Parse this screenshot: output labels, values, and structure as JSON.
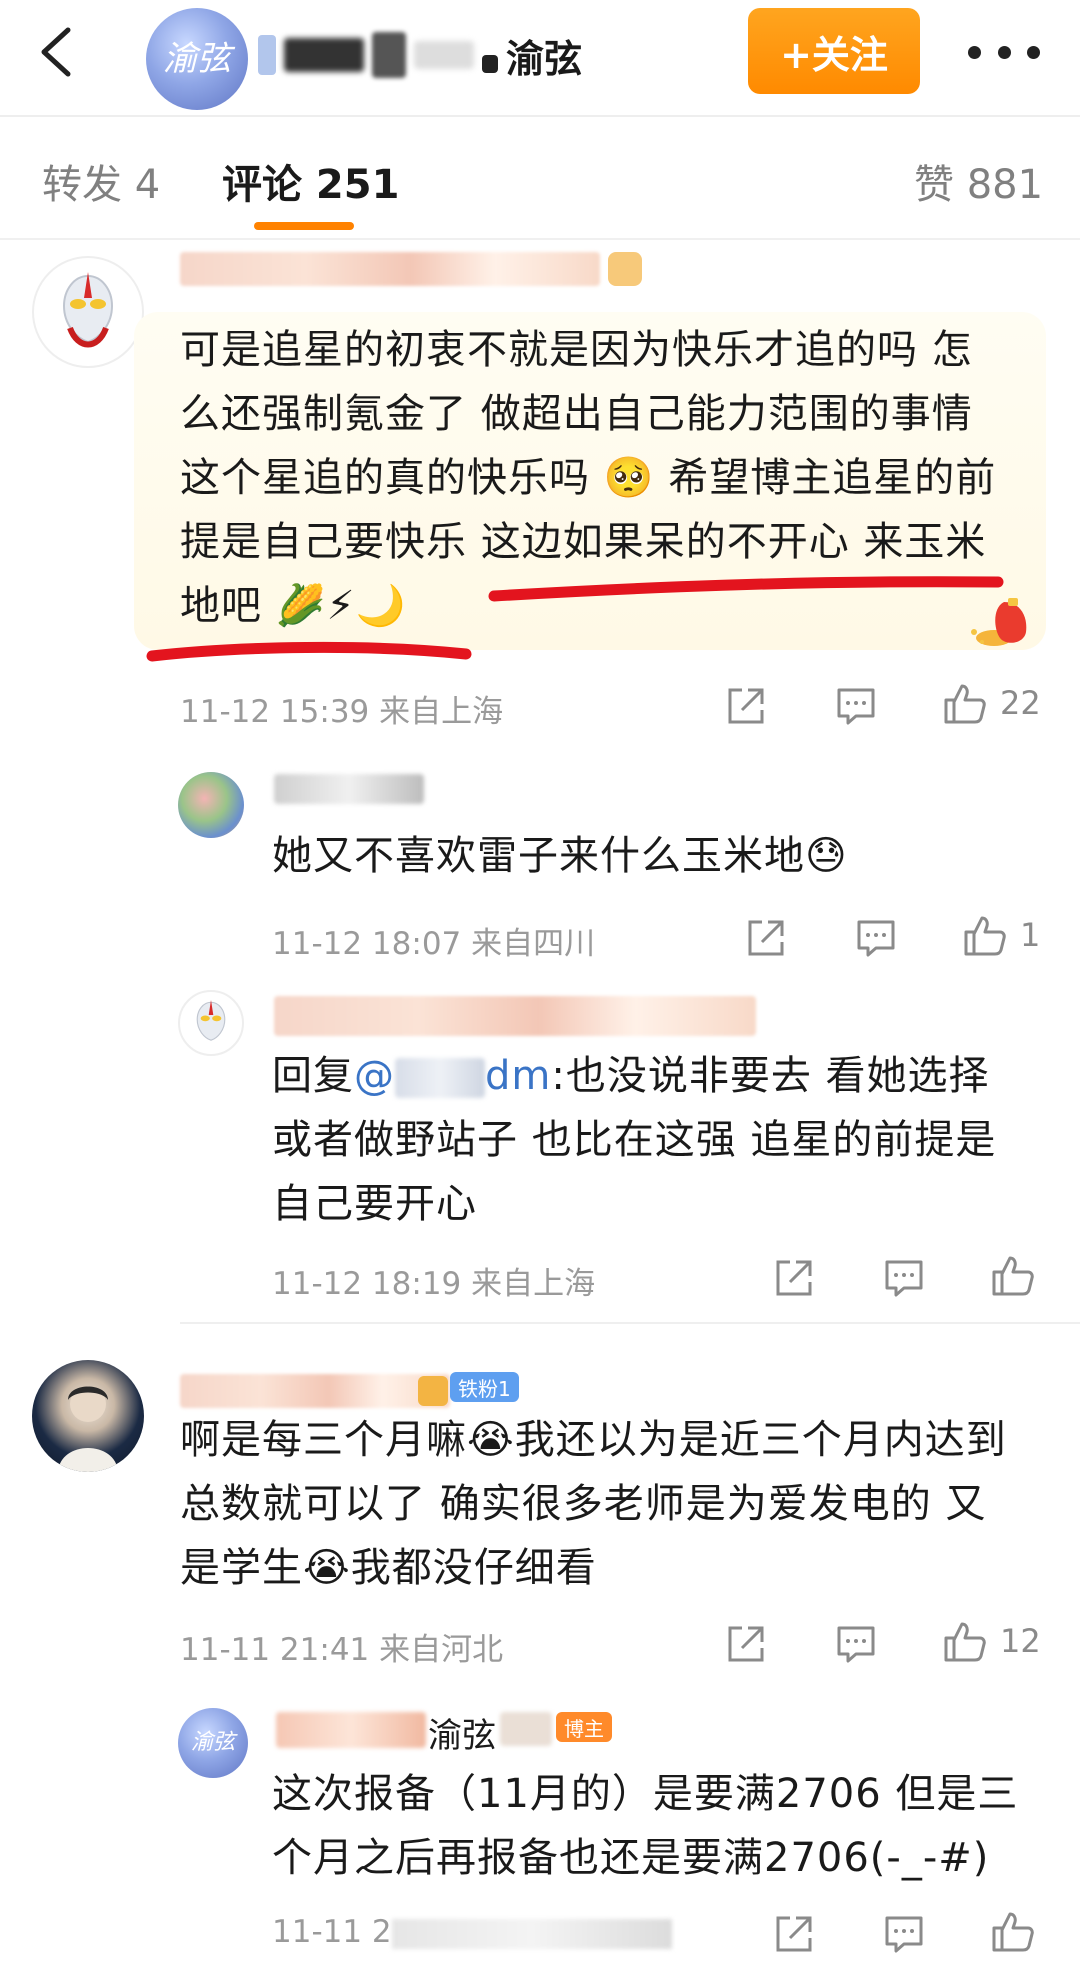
{
  "header": {
    "account_name_visible": "渝弦",
    "avatar_text": "渝弦",
    "follow_label": "+关注"
  },
  "tabs": [
    {
      "label": "转发 4"
    },
    {
      "label": "评论 251"
    },
    {
      "label": "赞 881"
    }
  ],
  "comments": [
    {
      "text_lines": [
        "可是追星的初衷不就是因为快乐才追的吗 怎",
        "么还强制氪金了 做超出自己能力范围的事情",
        "这个星追的真的快乐吗 🥺 希望博主追星的前",
        "提是自己要快乐 这边如果呆的不开心 来玉米",
        "地吧 🌽⚡🌙"
      ],
      "time": "11-12 15:39 来自上海",
      "likes": "22",
      "replies": [
        {
          "text_lines": [
            "她又不喜欢雷子来什么玉米地😓"
          ],
          "time": "11-12 18:07 来自四川",
          "likes": "1"
        },
        {
          "reply_prefix": "回复",
          "mention_visible": "@",
          "mention_tail": "dm",
          "text_first_rest": ":也没说非要去 看她选择",
          "text_lines_rest": [
            "或者做野站子 也比在这强 追星的前提是",
            "自己要开心"
          ],
          "time": "11-12 18:19 来自上海",
          "likes": ""
        }
      ]
    },
    {
      "badge": "铁粉1",
      "text_lines": [
        "啊是每三个月嘛😭我还以为是近三个月内达到",
        "总数就可以了 确实很多老师是为爱发电的 又",
        "是学生😭我都没仔细看"
      ],
      "time": "11-11 21:41 来自河北",
      "likes": "12",
      "replies": [
        {
          "name_visible": "渝弦",
          "badge": "博主",
          "text_lines": [
            "这次报备（11月的）是要满2706 但是三",
            "个月之后再报备也还是要满2706(-_-#)"
          ],
          "time": "11-11 2"
        }
      ]
    }
  ],
  "icons": {
    "share": "share-icon",
    "comment": "comment-icon",
    "like": "thumbs-up-icon",
    "back": "back-arrow-icon",
    "more": "more-dots-icon"
  },
  "colors": {
    "accent_orange": "#ff8200",
    "highlight_bg": "#fff9e6",
    "annotation_red": "#e3141e",
    "link_blue": "#3a74c6"
  }
}
